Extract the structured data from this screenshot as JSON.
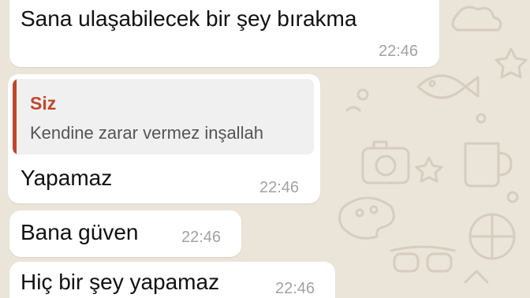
{
  "chat": {
    "messages": [
      {
        "text": "Sana ulaşabilecek bir şey bırakma",
        "time": "22:46"
      },
      {
        "quote": {
          "author": "Siz",
          "text": "Kendine zarar vermez inşallah"
        },
        "text": "Yapamaz",
        "time": "22:46"
      },
      {
        "text": "Bana güven",
        "time": "22:46"
      },
      {
        "text": "Hiç bir şey yapamaz",
        "time": "22:46"
      }
    ]
  },
  "colors": {
    "background": "#ebe4d9",
    "bubble": "#ffffff",
    "quote_accent": "#c0462b",
    "quote_background": "#f0f0f0",
    "timestamp": "#a2a2a2"
  },
  "wallpaper_icons": [
    "camera-icon",
    "mug-icon",
    "cloud-icon",
    "star-icon",
    "fish-icon",
    "sunglasses-icon",
    "palette-icon",
    "ball-icon"
  ]
}
